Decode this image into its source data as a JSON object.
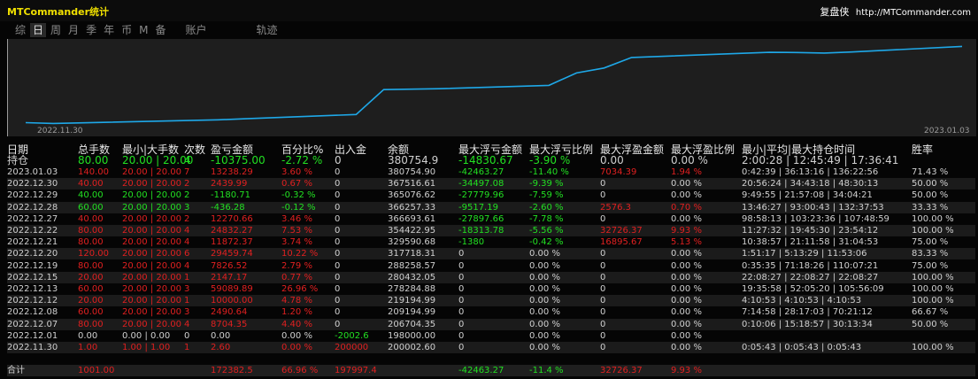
{
  "window": {
    "title": "MTCommander统计",
    "brand": "复盘侠",
    "url": "http://MTCommander.com"
  },
  "tabs": [
    "综",
    "日",
    "周",
    "月",
    "季",
    "年",
    "币",
    "M",
    "备",
    "账户",
    "轨迹"
  ],
  "active_tab": 1,
  "chart": {
    "start_label": "2022.11.30",
    "end_label": "2023.01.03",
    "x_dates": [
      "2022.11.30",
      "2022.12.01",
      "2022.12.07",
      "2022.12.08",
      "2022.12.12",
      "2022.12.13",
      "2022.12.15",
      "2022.12.19",
      "2022.12.20",
      "2022.12.21",
      "2022.12.22",
      "2022.12.27",
      "2022.12.28",
      "2022.12.29",
      "2022.12.30",
      "2023.01.03"
    ],
    "balance": [
      200002.6,
      198000.0,
      206704.35,
      209194.99,
      219194.99,
      278284.88,
      280432.05,
      288258.57,
      317718.31,
      329590.68,
      354422.95,
      366693.61,
      366257.33,
      365076.62,
      367516.61,
      380754.9
    ]
  },
  "columns": [
    "日期",
    "总手数",
    "最小|大手数",
    "次数",
    "盈亏金额",
    "百分比%",
    "出入金",
    "余额",
    "最大浮亏金额",
    "最大浮亏比例",
    "最大浮盈金额",
    "最大浮盈比例",
    "最小|平均|最大持仓时间",
    "胜率"
  ],
  "position_row": {
    "label": "持仓",
    "lots": "80.00",
    "minmax": "20.00 | 20.00",
    "count": "4",
    "pnl": "-10375.00",
    "pct": "-2.72 %",
    "flow": "0",
    "balance": "380754.9",
    "maxloss": "-14830.67",
    "maxlosspct": "-3.90 %",
    "maxprofit": "0.00",
    "maxprofitpct": "0.00 %",
    "hold": "2:00:28 | 12:45:49 | 17:36:41",
    "win": ""
  },
  "rows": [
    {
      "date": "2023.01.03",
      "lots": "140.00",
      "minmax": "20.00 | 20.00",
      "count": "7",
      "pnl": "13238.29",
      "pct": "3.60 %",
      "flow": "0",
      "balance": "380754.90",
      "maxloss": "-42463.27",
      "maxlosspct": "-11.40 %",
      "maxprofit": "7034.39",
      "maxprofitpct": "1.94 %",
      "hold": "0:42:39 | 36:13:16 | 136:22:56",
      "win": "71.43 %",
      "c": "r",
      "cp": "r",
      "cm": "r"
    },
    {
      "date": "2022.12.30",
      "lots": "40.00",
      "minmax": "20.00 | 20.00",
      "count": "2",
      "pnl": "2439.99",
      "pct": "0.67 %",
      "flow": "0",
      "balance": "367516.61",
      "maxloss": "-34497.08",
      "maxlosspct": "-9.39 %",
      "maxprofit": "0",
      "maxprofitpct": "0.00 %",
      "hold": "20:56:24 | 34:43:18 | 48:30:13",
      "win": "50.00 %",
      "c": "r",
      "cp": "w",
      "cm": "w"
    },
    {
      "date": "2022.12.29",
      "lots": "40.00",
      "minmax": "20.00 | 20.00",
      "count": "2",
      "pnl": "-1180.71",
      "pct": "-0.32 %",
      "flow": "0",
      "balance": "365076.62",
      "maxloss": "-27779.96",
      "maxlosspct": "-7.59 %",
      "maxprofit": "0",
      "maxprofitpct": "0.00 %",
      "hold": "9:49:55 | 21:57:08 | 34:04:21",
      "win": "50.00 %",
      "c": "g",
      "cp": "w",
      "cm": "w"
    },
    {
      "date": "2022.12.28",
      "lots": "60.00",
      "minmax": "20.00 | 20.00",
      "count": "3",
      "pnl": "-436.28",
      "pct": "-0.12 %",
      "flow": "0",
      "balance": "366257.33",
      "maxloss": "-9517.19",
      "maxlosspct": "-2.60 %",
      "maxprofit": "2576.3",
      "maxprofitpct": "0.70 %",
      "hold": "13:46:27 | 93:00:43 | 132:37:53",
      "win": "33.33 %",
      "c": "g",
      "cp": "r",
      "cm": "r"
    },
    {
      "date": "2022.12.27",
      "lots": "40.00",
      "minmax": "20.00 | 20.00",
      "count": "2",
      "pnl": "12270.66",
      "pct": "3.46 %",
      "flow": "0",
      "balance": "366693.61",
      "maxloss": "-27897.66",
      "maxlosspct": "-7.78 %",
      "maxprofit": "0",
      "maxprofitpct": "0.00 %",
      "hold": "98:58:13 | 103:23:36 | 107:48:59",
      "win": "100.00 %",
      "c": "r",
      "cp": "w",
      "cm": "w"
    },
    {
      "date": "2022.12.22",
      "lots": "80.00",
      "minmax": "20.00 | 20.00",
      "count": "4",
      "pnl": "24832.27",
      "pct": "7.53 %",
      "flow": "0",
      "balance": "354422.95",
      "maxloss": "-18313.78",
      "maxlosspct": "-5.56 %",
      "maxprofit": "32726.37",
      "maxprofitpct": "9.93 %",
      "hold": "11:27:32 | 19:45:30 | 23:54:12",
      "win": "100.00 %",
      "c": "r",
      "cp": "r",
      "cm": "r"
    },
    {
      "date": "2022.12.21",
      "lots": "80.00",
      "minmax": "20.00 | 20.00",
      "count": "4",
      "pnl": "11872.37",
      "pct": "3.74 %",
      "flow": "0",
      "balance": "329590.68",
      "maxloss": "-1380",
      "maxlosspct": "-0.42 %",
      "maxprofit": "16895.67",
      "maxprofitpct": "5.13 %",
      "hold": "10:38:57 | 21:11:58 | 31:04:53",
      "win": "75.00 %",
      "c": "r",
      "cp": "r",
      "cm": "r"
    },
    {
      "date": "2022.12.20",
      "lots": "120.00",
      "minmax": "20.00 | 20.00",
      "count": "6",
      "pnl": "29459.74",
      "pct": "10.22 %",
      "flow": "0",
      "balance": "317718.31",
      "maxloss": "0",
      "maxlosspct": "0.00 %",
      "maxprofit": "0",
      "maxprofitpct": "0.00 %",
      "hold": "1:51:17 | 5:13:29 | 11:53:06",
      "win": "83.33 %",
      "c": "r",
      "cp": "w",
      "cm": "w"
    },
    {
      "date": "2022.12.19",
      "lots": "80.00",
      "minmax": "20.00 | 20.00",
      "count": "4",
      "pnl": "7826.52",
      "pct": "2.79 %",
      "flow": "0",
      "balance": "288258.57",
      "maxloss": "0",
      "maxlosspct": "0.00 %",
      "maxprofit": "0",
      "maxprofitpct": "0.00 %",
      "hold": "0:35:35 | 71:18:26 | 110:07:21",
      "win": "75.00 %",
      "c": "r",
      "cp": "w",
      "cm": "w"
    },
    {
      "date": "2022.12.15",
      "lots": "20.00",
      "minmax": "20.00 | 20.00",
      "count": "1",
      "pnl": "2147.17",
      "pct": "0.77 %",
      "flow": "0",
      "balance": "280432.05",
      "maxloss": "0",
      "maxlosspct": "0.00 %",
      "maxprofit": "0",
      "maxprofitpct": "0.00 %",
      "hold": "22:08:27 | 22:08:27 | 22:08:27",
      "win": "100.00 %",
      "c": "r",
      "cp": "w",
      "cm": "w"
    },
    {
      "date": "2022.12.13",
      "lots": "60.00",
      "minmax": "20.00 | 20.00",
      "count": "3",
      "pnl": "59089.89",
      "pct": "26.96 %",
      "flow": "0",
      "balance": "278284.88",
      "maxloss": "0",
      "maxlosspct": "0.00 %",
      "maxprofit": "0",
      "maxprofitpct": "0.00 %",
      "hold": "19:35:58 | 52:05:20 | 105:56:09",
      "win": "100.00 %",
      "c": "r",
      "cp": "w",
      "cm": "w"
    },
    {
      "date": "2022.12.12",
      "lots": "20.00",
      "minmax": "20.00 | 20.00",
      "count": "1",
      "pnl": "10000.00",
      "pct": "4.78 %",
      "flow": "0",
      "balance": "219194.99",
      "maxloss": "0",
      "maxlosspct": "0.00 %",
      "maxprofit": "0",
      "maxprofitpct": "0.00 %",
      "hold": "4:10:53 | 4:10:53 | 4:10:53",
      "win": "100.00 %",
      "c": "r",
      "cp": "w",
      "cm": "w"
    },
    {
      "date": "2022.12.08",
      "lots": "60.00",
      "minmax": "20.00 | 20.00",
      "count": "3",
      "pnl": "2490.64",
      "pct": "1.20 %",
      "flow": "0",
      "balance": "209194.99",
      "maxloss": "0",
      "maxlosspct": "0.00 %",
      "maxprofit": "0",
      "maxprofitpct": "0.00 %",
      "hold": "7:14:58 | 28:17:03 | 70:21:12",
      "win": "66.67 %",
      "c": "r",
      "cp": "w",
      "cm": "w"
    },
    {
      "date": "2022.12.07",
      "lots": "80.00",
      "minmax": "20.00 | 20.00",
      "count": "4",
      "pnl": "8704.35",
      "pct": "4.40 %",
      "flow": "0",
      "balance": "206704.35",
      "maxloss": "0",
      "maxlosspct": "0.00 %",
      "maxprofit": "0",
      "maxprofitpct": "0.00 %",
      "hold": "0:10:06 | 15:18:57 | 30:13:34",
      "win": "50.00 %",
      "c": "r",
      "cp": "w",
      "cm": "w"
    },
    {
      "date": "2022.12.01",
      "lots": "0.00",
      "minmax": "0.00 | 0.00",
      "count": "0",
      "pnl": "0.00",
      "pct": "0.00 %",
      "flow": "-2002.6",
      "balance": "198000.00",
      "maxloss": "0",
      "maxlosspct": "0.00 %",
      "maxprofit": "0",
      "maxprofitpct": "0.00 %",
      "hold": "",
      "win": "",
      "c": "w",
      "cf": "g",
      "cp": "w",
      "cm": "w"
    },
    {
      "date": "2022.11.30",
      "lots": "1.00",
      "minmax": "1.00 | 1.00",
      "count": "1",
      "pnl": "2.60",
      "pct": "0.00 %",
      "flow": "200000",
      "balance": "200002.60",
      "maxloss": "0",
      "maxlosspct": "0.00 %",
      "maxprofit": "0",
      "maxprofitpct": "0.00 %",
      "hold": "0:05:43 | 0:05:43 | 0:05:43",
      "win": "100.00 %",
      "c": "r",
      "cf": "r",
      "cp": "w",
      "cm": "w"
    }
  ],
  "total_row": {
    "label": "合计",
    "lots": "1001.00",
    "pnl": "172382.5",
    "pct": "66.96 %",
    "flow": "197997.4",
    "maxloss": "-42463.27",
    "maxlosspct": "-11.4 %",
    "maxprofit": "32726.37",
    "maxprofitpct": "9.93 %"
  }
}
